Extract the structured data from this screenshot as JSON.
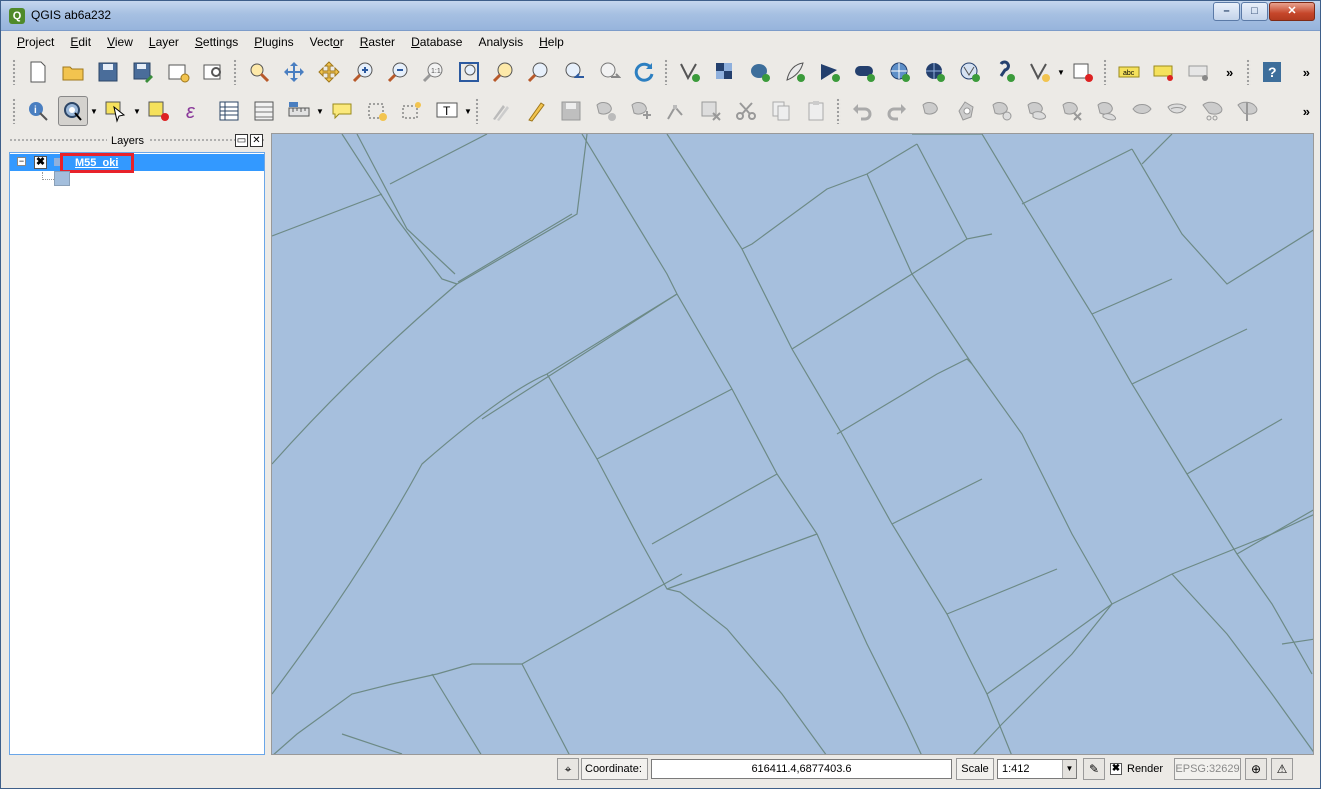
{
  "window": {
    "title": "QGIS ab6a232",
    "buttons": {
      "minimize": "–",
      "maximize": "□",
      "close": "✕"
    }
  },
  "menubar": {
    "items": [
      {
        "label": "Project",
        "ul": "P",
        "rest": "roject"
      },
      {
        "label": "Edit",
        "ul": "E",
        "rest": "dit"
      },
      {
        "label": "View",
        "ul": "V",
        "rest": "iew"
      },
      {
        "label": "Layer",
        "ul": "L",
        "rest": "ayer"
      },
      {
        "label": "Settings",
        "ul": "S",
        "rest": "ettings"
      },
      {
        "label": "Plugins",
        "ul": "P",
        "rest": "lugins"
      },
      {
        "label": "Vector",
        "ul": "o",
        "pre": "Vect",
        "rest": "r"
      },
      {
        "label": "Raster",
        "ul": "R",
        "rest": "aster"
      },
      {
        "label": "Database",
        "ul": "D",
        "rest": "atabase"
      },
      {
        "label": "Analysis",
        "ul": "",
        "rest": "Analysis"
      },
      {
        "label": "Help",
        "ul": "H",
        "rest": "elp"
      }
    ]
  },
  "toolbar": {
    "overflow": "»",
    "help_label": "?",
    "label_tool_text": "abc"
  },
  "layers_panel": {
    "title": "Layers",
    "float_button": "▭",
    "close_button": "✕",
    "expander": "−",
    "checkbox": "✖",
    "layer_name": "M55_oki"
  },
  "statusbar": {
    "coordinate_label": "Coordinate:",
    "coordinate_value": "616411.4,6877403.6",
    "scale_label": "Scale",
    "scale_value": "1:412",
    "render_label": "Render",
    "render_checkbox": "✖",
    "crs": "EPSG:32629",
    "warning_icon": "⚠"
  },
  "colors": {
    "map_fill": "#a6bfdd",
    "parcel_lines": "#6d8a86",
    "selection_highlight": "#3399ff",
    "annotation_box": "#e8222a"
  }
}
